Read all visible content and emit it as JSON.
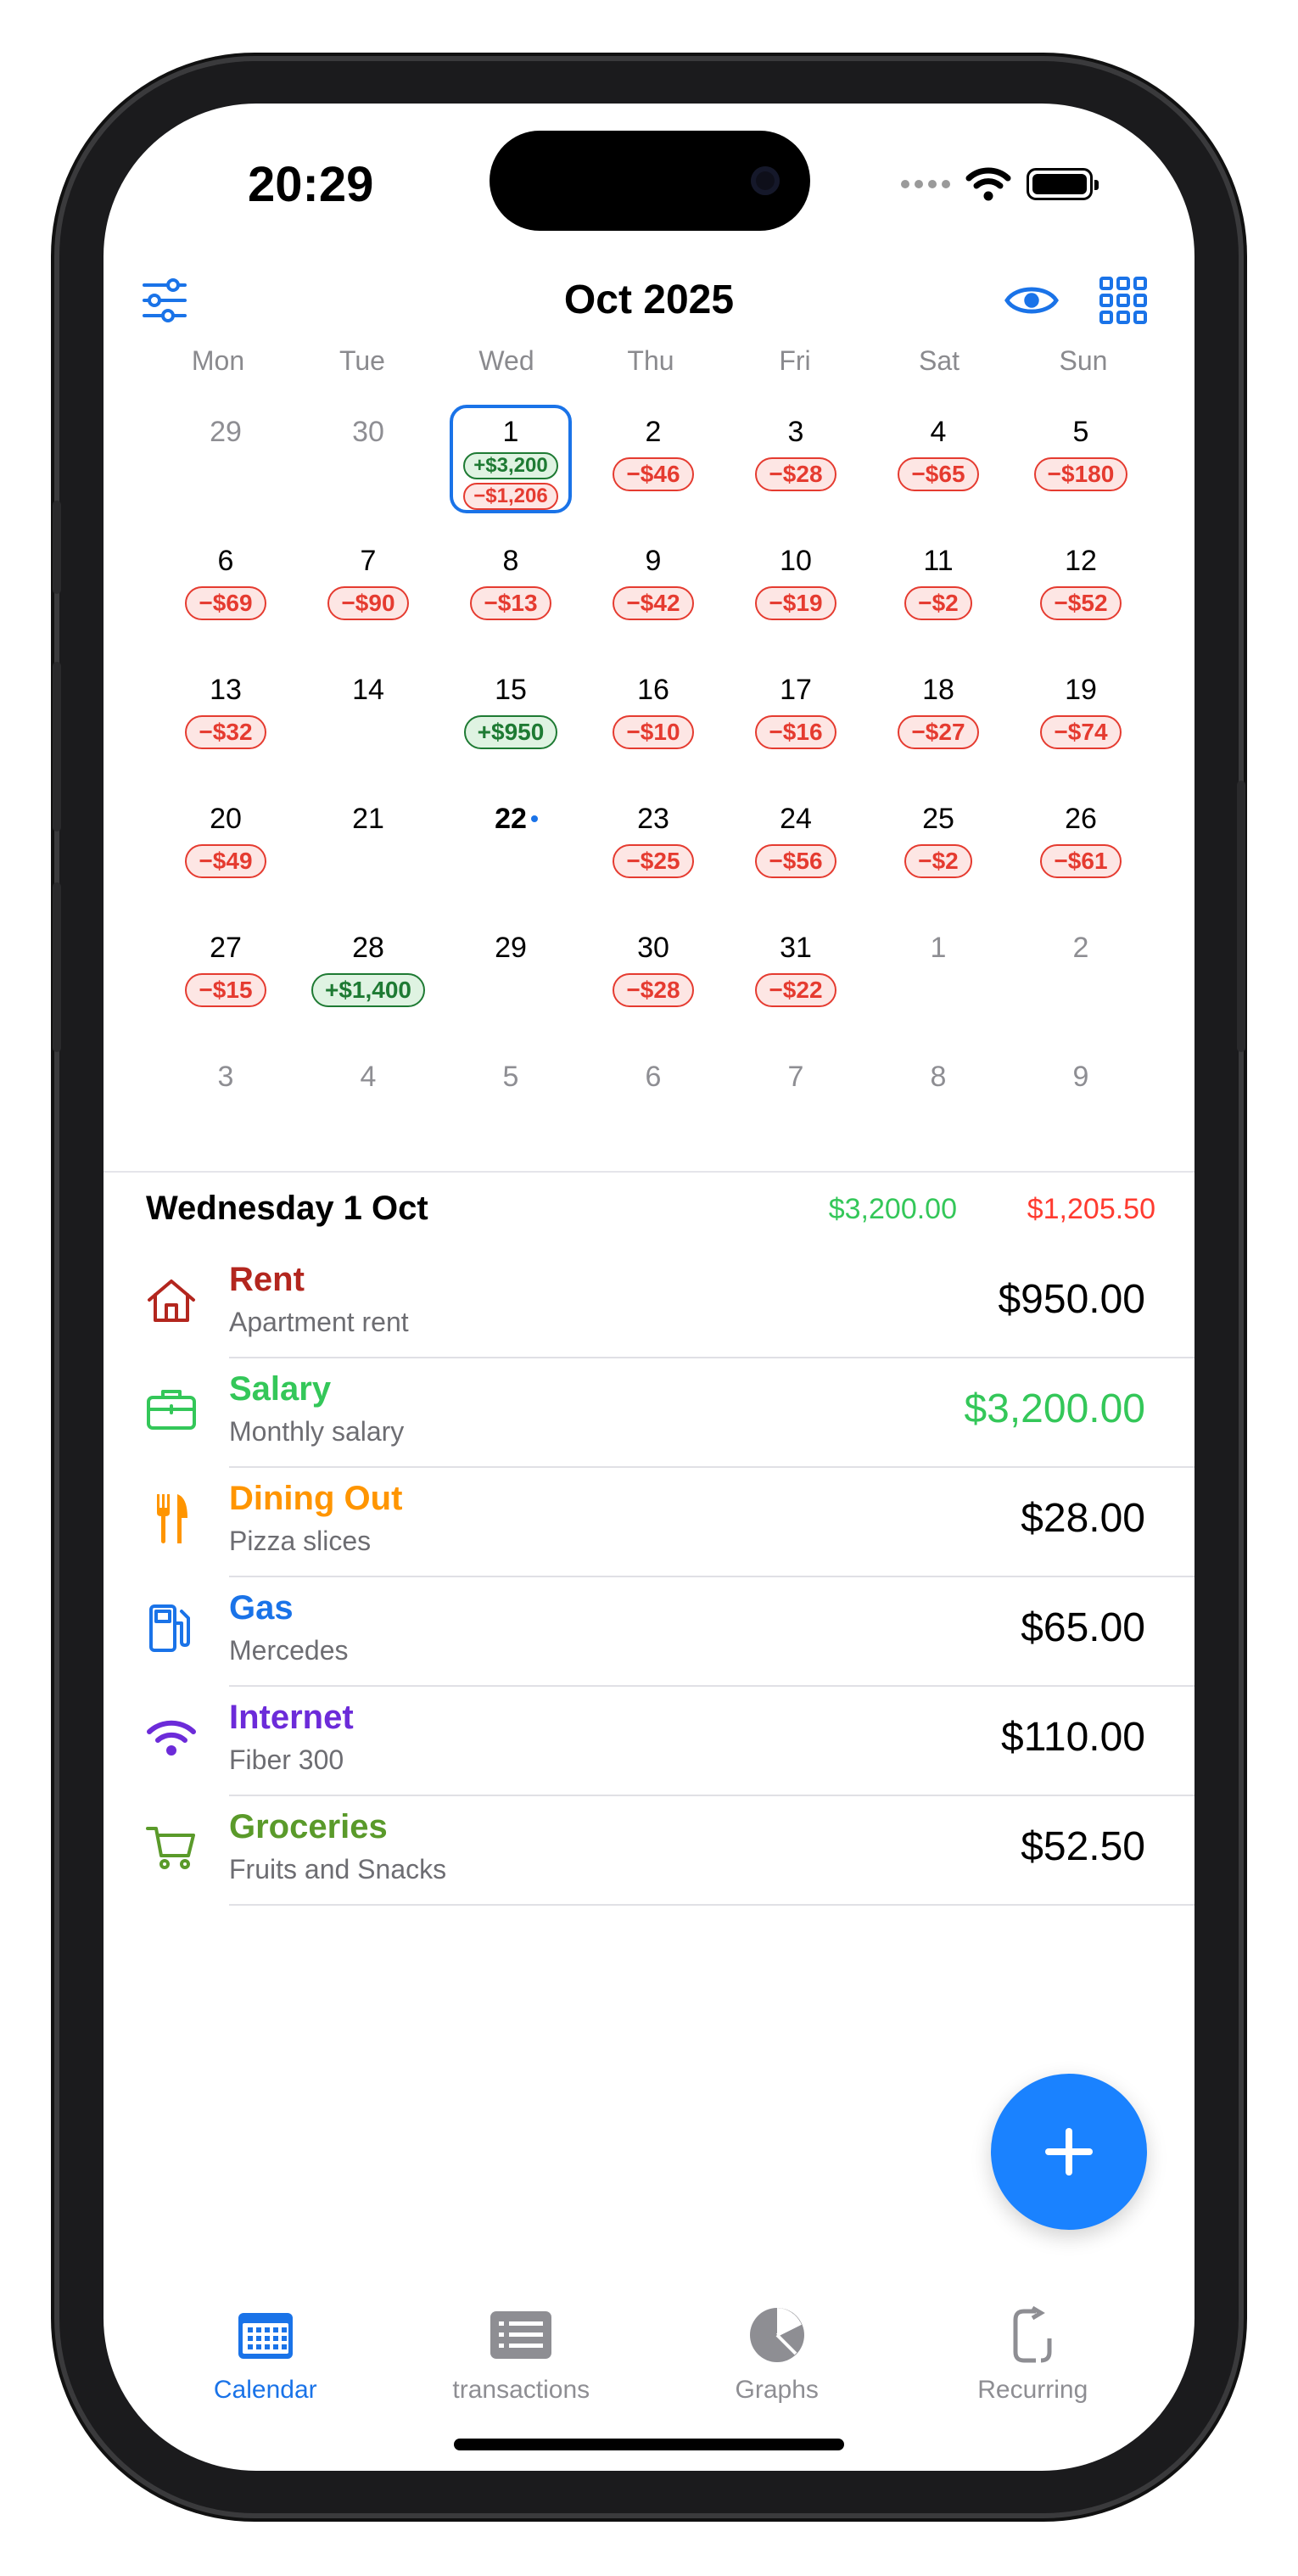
{
  "status_bar": {
    "time": "20:29"
  },
  "header": {
    "title": "Oct 2025",
    "filter_icon": "sliders-icon",
    "visibility_icon": "eye-icon",
    "grid_icon": "grid-icon"
  },
  "calendar": {
    "weekdays": [
      "Mon",
      "Tue",
      "Wed",
      "Thu",
      "Fri",
      "Sat",
      "Sun"
    ],
    "weeks": [
      [
        {
          "day": "29",
          "muted": true,
          "amounts": []
        },
        {
          "day": "30",
          "muted": true,
          "amounts": []
        },
        {
          "day": "1",
          "selected": true,
          "amounts": [
            {
              "text": "+$3,200",
              "type": "pos"
            },
            {
              "text": "−$1,206",
              "type": "neg"
            }
          ]
        },
        {
          "day": "2",
          "amounts": [
            {
              "text": "−$46",
              "type": "neg"
            }
          ]
        },
        {
          "day": "3",
          "amounts": [
            {
              "text": "−$28",
              "type": "neg"
            }
          ]
        },
        {
          "day": "4",
          "amounts": [
            {
              "text": "−$65",
              "type": "neg"
            }
          ]
        },
        {
          "day": "5",
          "amounts": [
            {
              "text": "−$180",
              "type": "neg"
            }
          ]
        }
      ],
      [
        {
          "day": "6",
          "amounts": [
            {
              "text": "−$69",
              "type": "neg"
            }
          ]
        },
        {
          "day": "7",
          "amounts": [
            {
              "text": "−$90",
              "type": "neg"
            }
          ]
        },
        {
          "day": "8",
          "amounts": [
            {
              "text": "−$13",
              "type": "neg"
            }
          ]
        },
        {
          "day": "9",
          "amounts": [
            {
              "text": "−$42",
              "type": "neg"
            }
          ]
        },
        {
          "day": "10",
          "amounts": [
            {
              "text": "−$19",
              "type": "neg"
            }
          ]
        },
        {
          "day": "11",
          "amounts": [
            {
              "text": "−$2",
              "type": "neg"
            }
          ]
        },
        {
          "day": "12",
          "amounts": [
            {
              "text": "−$52",
              "type": "neg"
            }
          ]
        }
      ],
      [
        {
          "day": "13",
          "amounts": [
            {
              "text": "−$32",
              "type": "neg"
            }
          ]
        },
        {
          "day": "14",
          "amounts": []
        },
        {
          "day": "15",
          "amounts": [
            {
              "text": "+$950",
              "type": "pos"
            }
          ]
        },
        {
          "day": "16",
          "amounts": [
            {
              "text": "−$10",
              "type": "neg"
            }
          ]
        },
        {
          "day": "17",
          "amounts": [
            {
              "text": "−$16",
              "type": "neg"
            }
          ]
        },
        {
          "day": "18",
          "amounts": [
            {
              "text": "−$27",
              "type": "neg"
            }
          ]
        },
        {
          "day": "19",
          "amounts": [
            {
              "text": "−$74",
              "type": "neg"
            }
          ]
        }
      ],
      [
        {
          "day": "20",
          "amounts": [
            {
              "text": "−$49",
              "type": "neg"
            }
          ]
        },
        {
          "day": "21",
          "amounts": []
        },
        {
          "day": "22",
          "today": true,
          "amounts": []
        },
        {
          "day": "23",
          "amounts": [
            {
              "text": "−$25",
              "type": "neg"
            }
          ]
        },
        {
          "day": "24",
          "amounts": [
            {
              "text": "−$56",
              "type": "neg"
            }
          ]
        },
        {
          "day": "25",
          "amounts": [
            {
              "text": "−$2",
              "type": "neg"
            }
          ]
        },
        {
          "day": "26",
          "amounts": [
            {
              "text": "−$61",
              "type": "neg"
            }
          ]
        }
      ],
      [
        {
          "day": "27",
          "amounts": [
            {
              "text": "−$15",
              "type": "neg"
            }
          ]
        },
        {
          "day": "28",
          "amounts": [
            {
              "text": "+$1,400",
              "type": "pos"
            }
          ]
        },
        {
          "day": "29",
          "amounts": []
        },
        {
          "day": "30",
          "amounts": [
            {
              "text": "−$28",
              "type": "neg"
            }
          ]
        },
        {
          "day": "31",
          "amounts": [
            {
              "text": "−$22",
              "type": "neg"
            }
          ]
        },
        {
          "day": "1",
          "muted": true,
          "amounts": []
        },
        {
          "day": "2",
          "muted": true,
          "amounts": []
        }
      ],
      [
        {
          "day": "3",
          "muted": true,
          "amounts": []
        },
        {
          "day": "4",
          "muted": true,
          "amounts": []
        },
        {
          "day": "5",
          "muted": true,
          "amounts": []
        },
        {
          "day": "6",
          "muted": true,
          "amounts": []
        },
        {
          "day": "7",
          "muted": true,
          "amounts": []
        },
        {
          "day": "8",
          "muted": true,
          "amounts": []
        },
        {
          "day": "9",
          "muted": true,
          "amounts": []
        }
      ]
    ]
  },
  "day_summary": {
    "title": "Wednesday 1 Oct",
    "income": "$3,200.00",
    "expense": "$1,205.50"
  },
  "transactions": [
    {
      "name": "Rent",
      "description": "Apartment rent",
      "amount": "$950.00",
      "color": "#b3261e",
      "icon": "house-icon",
      "amount_color": "#000000"
    },
    {
      "name": "Salary",
      "description": "Monthly salary",
      "amount": "$3,200.00",
      "color": "#34c759",
      "icon": "briefcase-icon",
      "amount_color": "#34c759"
    },
    {
      "name": "Dining Out",
      "description": "Pizza slices",
      "amount": "$28.00",
      "color": "#ff9500",
      "icon": "fork-knife-icon",
      "amount_color": "#000000"
    },
    {
      "name": "Gas",
      "description": "Mercedes",
      "amount": "$65.00",
      "color": "#1a73e8",
      "icon": "fuel-pump-icon",
      "amount_color": "#000000"
    },
    {
      "name": "Internet",
      "description": "Fiber 300",
      "amount": "$110.00",
      "color": "#6c2bd9",
      "icon": "wifi-icon",
      "amount_color": "#000000"
    },
    {
      "name": "Groceries",
      "description": "Fruits and Snacks",
      "amount": "$52.50",
      "color": "#5a9a2a",
      "icon": "cart-icon",
      "amount_color": "#000000"
    }
  ],
  "fab": {
    "icon": "plus-icon"
  },
  "tabs": [
    {
      "label": "Calendar",
      "icon": "calendar-icon",
      "active": true
    },
    {
      "label": "transactions",
      "icon": "list-icon",
      "active": false
    },
    {
      "label": "Graphs",
      "icon": "pie-chart-icon",
      "active": false
    },
    {
      "label": "Recurring",
      "icon": "recurring-icon",
      "active": false
    }
  ],
  "colors": {
    "accent": "#1a73e8",
    "income": "#34c759",
    "expense": "#ff3b30"
  }
}
